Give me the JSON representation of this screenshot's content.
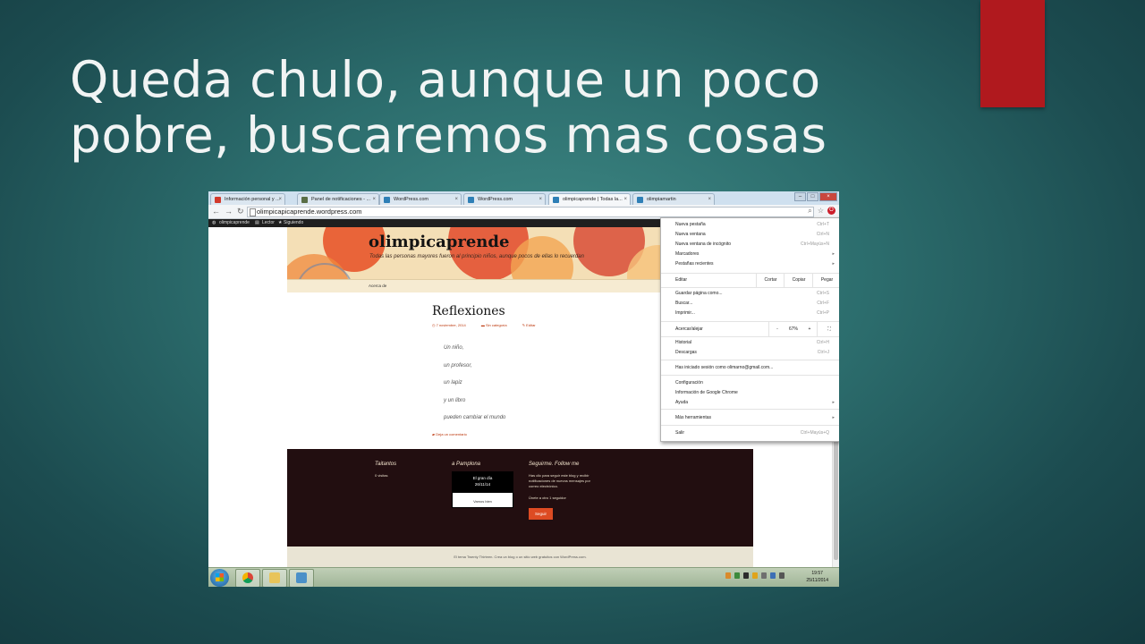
{
  "slide": {
    "title_line1": "Queda chulo, aunque un poco",
    "title_line2": "pobre, buscaremos mas cosas"
  },
  "browser": {
    "tabs": [
      {
        "label": "Información personal y ..."
      },
      {
        "label": "Panel de notificaciones - ..."
      },
      {
        "label": "WordPress.com"
      },
      {
        "label": "WordPress.com"
      },
      {
        "label": "olimpicaprende | Todas la..."
      },
      {
        "label": "olimpiamartin"
      }
    ],
    "url": "olimpicapicaprende.wordpress.com"
  },
  "admin_bar": {
    "site": "olimpicaprende",
    "reader": "Lector",
    "following": "Siguiendo"
  },
  "site": {
    "title": "olimpicaprende",
    "description": "Todas las personas mayores fueron al principio niños, aunque pocos de ellas lo recuerdan",
    "nav_item": "Acerca de"
  },
  "post": {
    "title": "Reflexiones",
    "date": "7 noviembre, 2014",
    "category": "Sin categoría",
    "edit": "Editar",
    "lines": [
      "Un niño,",
      "un profesor,",
      "un lapiz",
      "y un libro",
      "pueden cambiar el mundo"
    ],
    "comment": "Deja un comentario"
  },
  "footer": {
    "w1_title": "Taitantos",
    "w1_text": "0 visitas",
    "w2_title": "a Pamplona",
    "w2_card_line1": "El gran día",
    "w2_card_line2": "26/11/14",
    "w2_card_bottom": "Vamos bien",
    "w3_title": "Seguirme. Follow me",
    "w3_text": "Has clic para seguir este blog y recibir notificaciones de nuevos mensajes por correo electrónico.",
    "w3_followers": "Únete a otro 1 seguidor",
    "follow_button": "Seguir",
    "credits": "El tema Twenty Thirteen. Crea un blog o un sitio web gratuitos con WordPress.com."
  },
  "chrome_menu": {
    "new_tab": "Nueva pestaña",
    "new_tab_sc": "Ctrl+T",
    "new_window": "Nueva ventana",
    "new_window_sc": "Ctrl+N",
    "incognito": "Nueva ventana de incógnito",
    "incognito_sc": "Ctrl+Mayús+N",
    "bookmarks": "Marcadores",
    "recent_tabs": "Pestañas recientes",
    "edit": "Editar",
    "cut": "Cortar",
    "copy": "Copiar",
    "paste": "Pegar",
    "save_page": "Guardar página como...",
    "save_page_sc": "Ctrl+S",
    "find": "Buscar...",
    "find_sc": "Ctrl+F",
    "print": "Imprimir...",
    "print_sc": "Ctrl+P",
    "zoom": "Acercar/alejar",
    "zoom_minus": "-",
    "zoom_value": "67%",
    "zoom_plus": "+",
    "history": "Historial",
    "history_sc": "Ctrl+H",
    "downloads": "Descargas",
    "downloads_sc": "Ctrl+J",
    "signed_in": "Has iniciado sesión como olimarno@gmail.com...",
    "settings": "Configuración",
    "about": "Información de Google Chrome",
    "help": "Ayuda",
    "more_tools": "Más herramientas",
    "exit": "Salir",
    "exit_sc": "Ctrl+Mayús+Q"
  },
  "taskbar": {
    "time": "19:57",
    "date": "25/11/2014"
  },
  "colors": {
    "slide_bg": "#2c6d6d",
    "accent_red": "#b0191e",
    "footer_bg": "#220e10",
    "link_orange": "#bc360a"
  }
}
